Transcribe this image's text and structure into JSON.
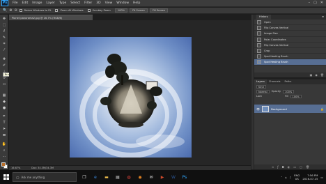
{
  "app": {
    "logo": "Ps"
  },
  "menubar": {
    "items": [
      "File",
      "Edit",
      "Image",
      "Layer",
      "Type",
      "Select",
      "Filter",
      "3D",
      "View",
      "Window",
      "Help"
    ]
  },
  "options_bar": {
    "resize_windows_label": "Resize Windows to Fit",
    "zoom_all_label": "Zoom All Windows",
    "scrubby_zoom_label": "Scrubby Zoom",
    "btn_100": "100%",
    "btn_fit": "Fit Screen",
    "btn_fill": "Fill Screen"
  },
  "document": {
    "tab_title": "Planet panorama2.jpg @ 16.7% (RGB/8)",
    "status_zoom": "16.67%",
    "status_doc": "Doc: 34.3M/34.3M"
  },
  "tooltip": {
    "text": "Brush Tool (B)"
  },
  "history": {
    "tab": "History",
    "items": [
      {
        "label": "Open",
        "selected": false
      },
      {
        "label": "Flip Canvas Vertical",
        "selected": false
      },
      {
        "label": "Image Size",
        "selected": false
      },
      {
        "label": "Polar Coordinates",
        "selected": false
      },
      {
        "label": "Flip Canvas Vertical",
        "selected": false
      },
      {
        "label": "Crop",
        "selected": false
      },
      {
        "label": "Spot Healing Brush",
        "selected": false
      },
      {
        "label": "Spot Healing Brush",
        "selected": true
      }
    ]
  },
  "layers": {
    "tabs": [
      "Layers",
      "Channels",
      "Paths"
    ],
    "kind_label": "Kind",
    "blend_mode": "Normal",
    "opacity_label": "Opacity",
    "opacity_value": "100%",
    "lock_label": "Lock",
    "fill_label": "Fill",
    "fill_value": "100%",
    "layer_name": "Background"
  },
  "taskbar": {
    "search_placeholder": "Ask me anything",
    "tray_lang": "ENG",
    "tray_region": "US",
    "time": "7:56 PM",
    "date": "2016-07-15"
  },
  "colors": {
    "accent_selected": "#576e93",
    "fg_swatch": "#b96f2a",
    "bg_swatch": "#ffffff"
  }
}
